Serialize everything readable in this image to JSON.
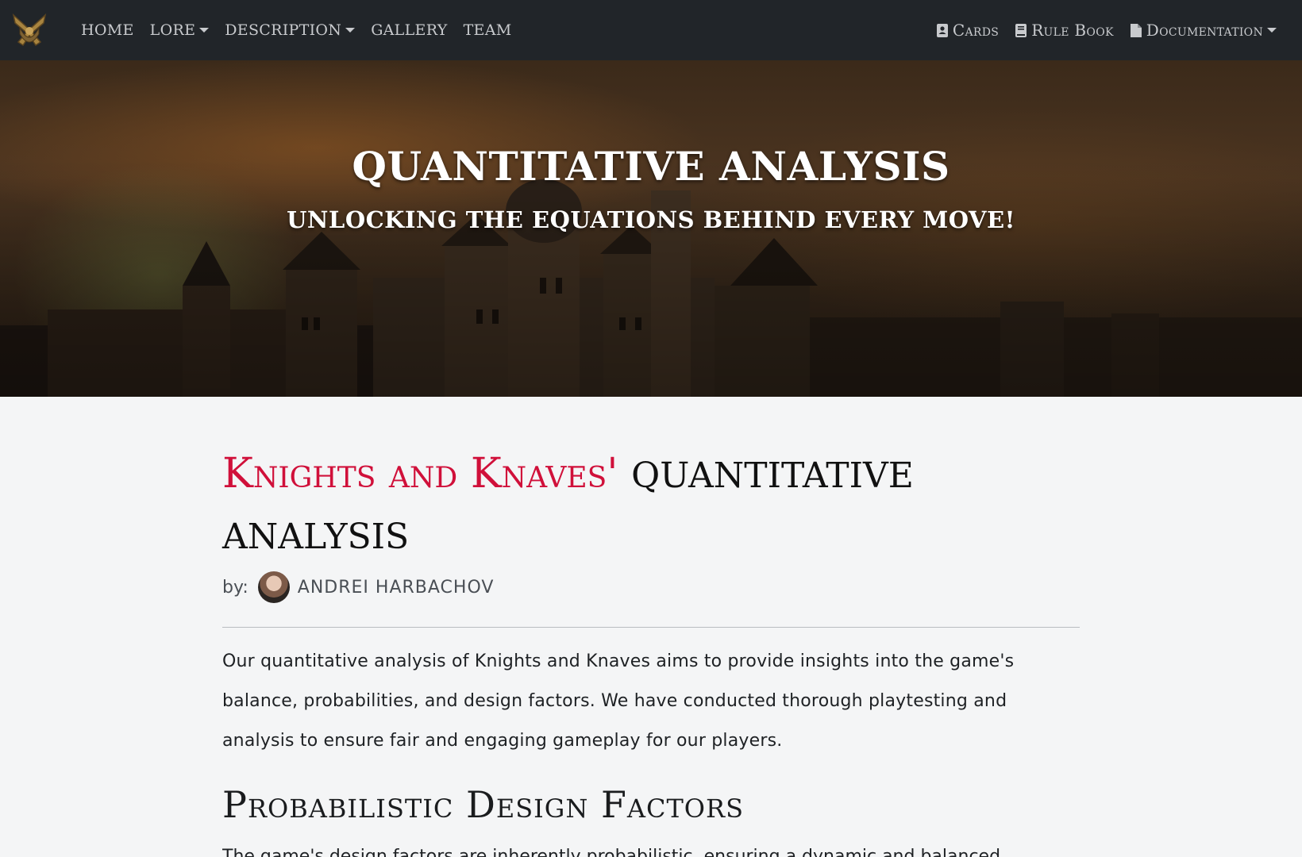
{
  "nav": {
    "left": [
      {
        "label": "HOME",
        "dropdown": false
      },
      {
        "label": "LORE",
        "dropdown": true
      },
      {
        "label": "DESCRIPTION",
        "dropdown": true
      },
      {
        "label": "GALLERY",
        "dropdown": false
      },
      {
        "label": "TEAM",
        "dropdown": false
      }
    ],
    "right": [
      {
        "label": "Cards",
        "icon": "address-card-icon",
        "dropdown": false
      },
      {
        "label": "Rule Book",
        "icon": "book-icon",
        "dropdown": false
      },
      {
        "label": "Documentation",
        "icon": "file-icon",
        "dropdown": true
      }
    ]
  },
  "hero": {
    "title": "QUANTITATIVE ANALYSIS",
    "subtitle": "UNLOCKING THE EQUATIONS BEHIND EVERY MOVE!"
  },
  "article": {
    "title_accent": "Knights and Knaves'",
    "title_rest": "quantitative analysis",
    "by_label": "by:",
    "author": "ANDREI HARBACHOV",
    "intro": "Our quantitative analysis of Knights and Knaves aims to provide insights into the game's balance, probabilities, and design factors. We have conducted thorough playtesting and analysis to ensure fair and engaging gameplay for our players.",
    "section_title": "Probabilistic Design Factors",
    "section_text": "The game's design factors are inherently probabilistic, ensuring a dynamic and balanced"
  },
  "colors": {
    "navbar_bg": "#212529",
    "accent": "#d0103a"
  }
}
